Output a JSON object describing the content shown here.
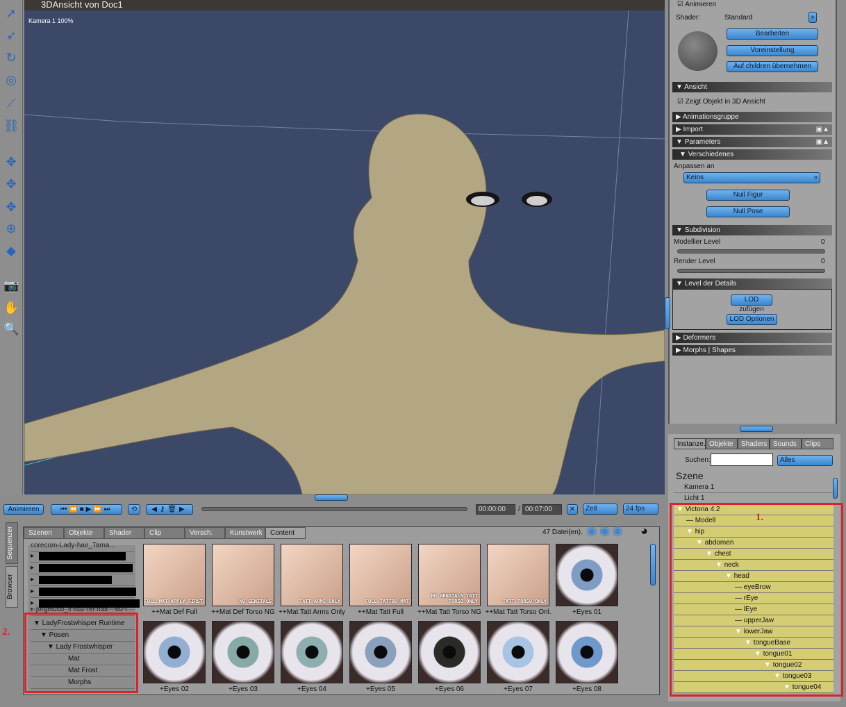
{
  "window": {
    "title": "3DAnsicht von Doc1",
    "camera_label": "Kamera 1 100%"
  },
  "toolbar": {
    "icons": [
      "select-arrow-icon",
      "direct-select-icon",
      "rotate-icon",
      "twist-icon",
      "taper-icon",
      "chain-icon",
      "translate-in-out-icon",
      "translate-xy-icon",
      "translate-xz-icon",
      "scale-icon",
      "morph-icon",
      "camera-icon",
      "hand-icon",
      "zoom-icon"
    ]
  },
  "properties": {
    "animate_label": "Animieren",
    "shader_label": "Shader:",
    "shader_value": "Standard",
    "edit_button": "Bearbeiten",
    "preset_button": "Voreinstellung",
    "apply_children_button": "Auf children übernehmen",
    "sections": {
      "view": "Ansicht",
      "animgroup": "Animationsgruppe",
      "import": "Import",
      "parameters": "Parameters",
      "misc": "Verschiedenes",
      "subdivision": "Subdivision",
      "lod": "Level der Details",
      "deformers": "Deformers",
      "morphs": "Morphs | Shapes"
    },
    "show_in_3d": "Zeigt Objekt in 3D Ansicht",
    "fit_to_label": "Anpassen an",
    "fit_to_value": "Keins",
    "null_figure_button": "Null Figur",
    "null_pose_button": "Null Pose",
    "model_level_label": "Modellier Level",
    "model_level_value": "0",
    "render_level_label": "Render Level",
    "render_level_value": "0",
    "lod_add_button": "LOD zufügen",
    "lod_options_button": "LOD Optionen"
  },
  "timeline": {
    "animate_button": "Animieren",
    "time_current": "00:00:00",
    "separator": "/",
    "time_end": "00:07:00",
    "mode": "Zeit",
    "fps": "24 fps",
    "progress": 0
  },
  "browser": {
    "side_tabs": [
      "Sequenzer",
      "Browser"
    ],
    "tabs": [
      "Szenen",
      "Objekte",
      "Shader",
      "Clip",
      "Versch.",
      "Kunstwerk",
      "Content"
    ],
    "active_tab": "Content",
    "file_count": "47 Datei(en).",
    "tree": {
      "partial_top": "corecom-Lady-hair_Tama...",
      "partial_item": "jorgeluso_il-koz-rei-hair---60-f",
      "items": [
        "LadyFrostwhisper Runtime",
        "Posen",
        "Lady Frostwhisper",
        "Mat",
        "Mat Frost",
        "Morphs"
      ]
    },
    "items": [
      {
        "label": "++Mat Def Full",
        "tag": "FULL MAT APPLY FIRST"
      },
      {
        "label": "++Mat Def Torso NG",
        "tag": "NO GENITALS"
      },
      {
        "label": "++Mat Tatt Arms Only",
        "tag": "TATT ARMS ONLY"
      },
      {
        "label": "++Mat Tatt Full",
        "tag": "FULL TATTOO MAT"
      },
      {
        "label": "++Mat Tatt Torso NG",
        "tag": "NO GENITALS TATT TORSO ONLY"
      },
      {
        "label": "++Mat Tatt Torso Onl.",
        "tag": "TATT TORSO ONLY"
      },
      {
        "label": "+Eyes 01",
        "iris": "#7f9cc4"
      },
      {
        "label": "+Eyes 02",
        "iris": "#92aed0"
      },
      {
        "label": "+Eyes 03",
        "iris": "#86aaa6"
      },
      {
        "label": "+Eyes 04",
        "iris": "#8eaeb0"
      },
      {
        "label": "+Eyes 05",
        "iris": "#8aa0bc"
      },
      {
        "label": "+Eyes 06",
        "iris": "#2a2a26"
      },
      {
        "label": "+Eyes 07",
        "iris": "#a8c4e4"
      },
      {
        "label": "+Eyes 08",
        "iris": "#6f98cc"
      }
    ],
    "annotation": "2."
  },
  "scene": {
    "tabs": [
      "Instanze.",
      "Objekte",
      "Shaders",
      "Sounds",
      "Clips"
    ],
    "search_label": "Suchen:",
    "search_value": "",
    "filter": "Alles",
    "heading": "Szene",
    "items": [
      "Kamera 1",
      "Licht 1"
    ],
    "hierarchy": [
      "Victoria 4.2",
      "Modell",
      "hip",
      "abdomen",
      "chest",
      "neck",
      "head",
      "eyeBrow",
      "rEye",
      "lEye",
      "upperJaw",
      "lowerJaw",
      "tongueBase",
      "tongue01",
      "tongue02",
      "tongue03",
      "tongue04"
    ],
    "annotation": "1."
  },
  "colors": {
    "accent": "#3b86cf",
    "highlight": "#d5cd74",
    "annotation": "#d8242a",
    "viewport": "#3b4868"
  }
}
